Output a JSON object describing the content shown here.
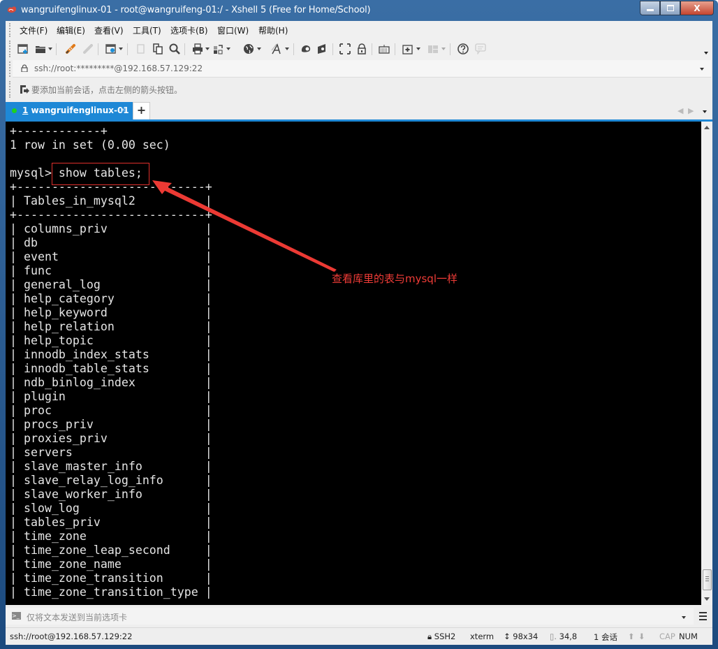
{
  "window": {
    "title": "wangruifenglinux-01 - root@wangruifeng-01:/ - Xshell 5 (Free for Home/School)",
    "controls": {
      "minimize": "—",
      "maximize": "□",
      "close": "X"
    }
  },
  "menubar": {
    "items": [
      "文件(F)",
      "编辑(E)",
      "查看(V)",
      "工具(T)",
      "选项卡(B)",
      "窗口(W)",
      "帮助(H)"
    ]
  },
  "toolbar": {
    "icons": [
      "new-session-icon",
      "open-folder-icon",
      "connect-icon",
      "disconnect-icon",
      "session-properties-icon",
      "copy-icon",
      "paste-icon",
      "find-icon",
      "print-icon",
      "transfer-icon",
      "globe-icon",
      "font-icon",
      "xftp-icon",
      "xmanager-icon",
      "fullscreen-icon",
      "lock-icon",
      "keyboard-icon",
      "new-tab-group-icon",
      "layout-icon",
      "help-icon",
      "chat-icon"
    ]
  },
  "addressbar": {
    "value": "ssh://root:*********@192.168.57.129:22"
  },
  "sessionbar": {
    "hint": "要添加当前会话，点击左侧的箭头按钮。"
  },
  "tabs": {
    "active": {
      "number": "1",
      "label": " wangruifenglinux-01",
      "close": "×"
    },
    "add_label": "+",
    "nav_prev": "◀",
    "nav_next": "▶"
  },
  "terminal": {
    "lines": [
      "+------------+",
      "1 row in set (0.00 sec)",
      "",
      "mysql> show tables;",
      "+---------------------------+",
      "| Tables_in_mysql2          |",
      "+---------------------------+",
      "| columns_priv              |",
      "| db                        |",
      "| event                     |",
      "| func                      |",
      "| general_log               |",
      "| help_category             |",
      "| help_keyword              |",
      "| help_relation             |",
      "| help_topic                |",
      "| innodb_index_stats        |",
      "| innodb_table_stats        |",
      "| ndb_binlog_index          |",
      "| plugin                    |",
      "| proc                      |",
      "| procs_priv                |",
      "| proxies_priv              |",
      "| servers                   |",
      "| slave_master_info         |",
      "| slave_relay_log_info      |",
      "| slave_worker_info         |",
      "| slow_log                  |",
      "| tables_priv               |",
      "| time_zone                 |",
      "| time_zone_leap_second     |",
      "| time_zone_name            |",
      "| time_zone_transition      |",
      "| time_zone_transition_type |"
    ],
    "annotation": "查看库里的表与mysql一样",
    "annotation_color": "#f03c37",
    "scroll_position": 0.98
  },
  "composebar": {
    "placeholder": "仅将文本发送到当前选项卡"
  },
  "statusbar": {
    "connection": "ssh://root@192.168.57.129:22",
    "protocol": "SSH2",
    "terminal_type": "xterm",
    "size": "98x34",
    "cursor": "34,8",
    "sessions": "1 会话",
    "cap": "CAP",
    "num": "NUM"
  },
  "colors": {
    "accent": "#1e88d6",
    "terminal_bg": "#000000",
    "terminal_fg": "#e6e6e6",
    "annotation": "#e0302c"
  }
}
